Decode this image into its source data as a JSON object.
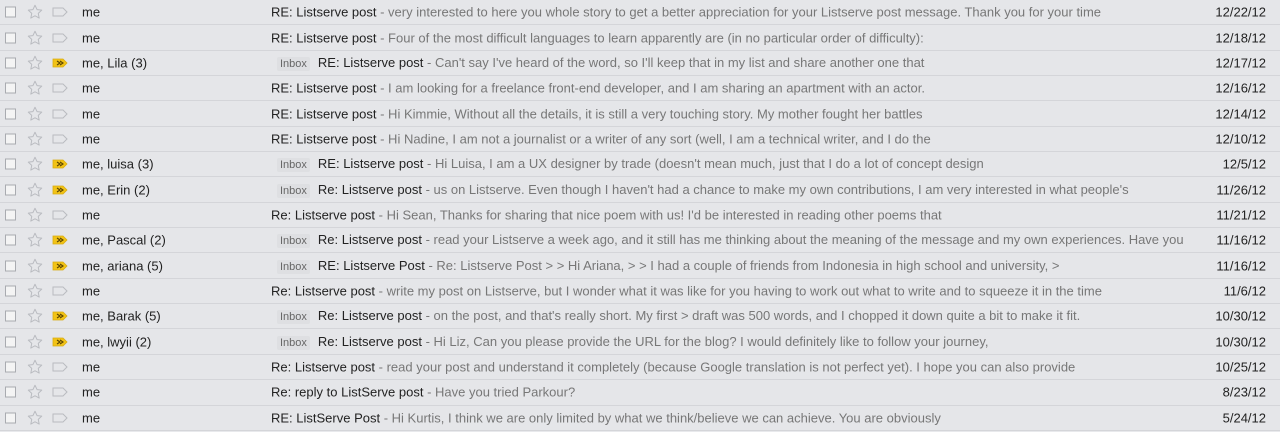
{
  "colors": {
    "row_bg": "#e5e6e9",
    "important_marker": "#f2c316",
    "snippet_text": "#777777",
    "label_text": "#666666"
  },
  "icons": {
    "checkbox": "checkbox-icon",
    "star": "star-icon",
    "importance_marker": "importance-marker-icon"
  },
  "rows": [
    {
      "sender": "me",
      "label": "",
      "important": false,
      "subject": "RE: Listserve post",
      "snippet": " - very interested to here you whole story to get a better appreciation for your Listserve post message. Thank you for your time",
      "date": "12/22/12"
    },
    {
      "sender": "me",
      "label": "",
      "important": false,
      "subject": "RE: Listserve post",
      "snippet": " - Four of the most difficult languages to learn apparently are (in no particular order of difficulty):",
      "date": "12/18/12"
    },
    {
      "sender": "me, Lila (3)",
      "label": "Inbox",
      "important": true,
      "subject": "RE: Listserve post",
      "snippet": " - Can't say I've heard of the word, so I'll keep that in my list and share another one that",
      "date": "12/17/12"
    },
    {
      "sender": "me",
      "label": "",
      "important": false,
      "subject": "RE: Listserve post",
      "snippet": " - I am looking for a freelance front-end developer, and I am sharing an apartment with an actor.",
      "date": "12/16/12"
    },
    {
      "sender": "me",
      "label": "",
      "important": false,
      "subject": "RE: Listserve post",
      "snippet": " - Hi Kimmie, Without all the details, it is still a very touching story. My mother fought her battles",
      "date": "12/14/12"
    },
    {
      "sender": "me",
      "label": "",
      "important": false,
      "subject": "RE: Listserve post",
      "snippet": " - Hi Nadine, I am not a journalist or a writer of any sort (well, I am a technical writer, and I do the",
      "date": "12/10/12"
    },
    {
      "sender": "me, luisa (3)",
      "label": "Inbox",
      "important": true,
      "subject": "RE: Listserve post",
      "snippet": " - Hi Luisa, I am a UX designer by trade (doesn't mean much, just that I do a lot of concept design",
      "date": "12/5/12"
    },
    {
      "sender": "me, Erin (2)",
      "label": "Inbox",
      "important": true,
      "subject": "Re: Listserve post",
      "snippet": " - us on Listserve. Even though I haven't had a chance to make my own contributions, I am very interested in what people's",
      "date": "11/26/12"
    },
    {
      "sender": "me",
      "label": "",
      "important": false,
      "subject": "Re: Listserve post",
      "snippet": " - Hi Sean, Thanks for sharing that nice poem with us! I'd be interested in reading other poems that",
      "date": "11/21/12"
    },
    {
      "sender": "me, Pascal (2)",
      "label": "Inbox",
      "important": true,
      "subject": "Re: Listserve post",
      "snippet": " - read your Listserve a week ago, and it still has me thinking about the meaning of the message and my own experiences. Have you",
      "date": "11/16/12"
    },
    {
      "sender": "me, ariana (5)",
      "label": "Inbox",
      "important": true,
      "subject": "RE: Listserve Post",
      "snippet": " - Re: Listserve Post > > Hi Ariana, > > I had a couple of friends from Indonesia in high school and university, >",
      "date": "11/16/12"
    },
    {
      "sender": "me",
      "label": "",
      "important": false,
      "subject": "Re: Listserve post",
      "snippet": " - write my post on Listserve, but I wonder what it was like for you having to work out what to write and to squeeze it in the time",
      "date": "11/6/12"
    },
    {
      "sender": "me, Barak (5)",
      "label": "Inbox",
      "important": true,
      "subject": "Re: Listserve post",
      "snippet": " - on the post, and that's really short. My first > draft was 500 words, and I chopped it down quite a bit to make it fit.",
      "date": "10/30/12"
    },
    {
      "sender": "me, lwyii (2)",
      "label": "Inbox",
      "important": true,
      "subject": "Re: Listserve post",
      "snippet": " - Hi Liz, Can you please provide the URL for the blog? I would definitely like to follow your journey,",
      "date": "10/30/12"
    },
    {
      "sender": "me",
      "label": "",
      "important": false,
      "subject": "Re: Listserve post",
      "snippet": " - read your post and understand it completely (because Google translation is not perfect yet). I hope you can also provide",
      "date": "10/25/12"
    },
    {
      "sender": "me",
      "label": "",
      "important": false,
      "subject": "Re: reply to ListServe post",
      "snippet": " - Have you tried Parkour?",
      "date": "8/23/12"
    },
    {
      "sender": "me",
      "label": "",
      "important": false,
      "subject": "RE: ListServe Post",
      "snippet": " - Hi Kurtis, I think we are only limited by what we think/believe we can achieve. You are obviously",
      "date": "5/24/12"
    }
  ]
}
